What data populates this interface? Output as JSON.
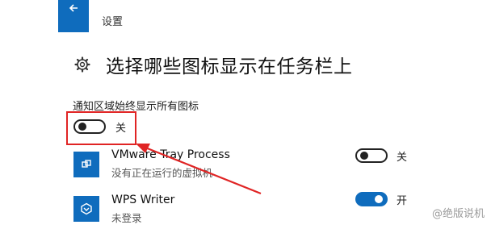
{
  "header": {
    "window_title": "设置"
  },
  "page": {
    "title": "选择哪些图标显示在任务栏上"
  },
  "always_show": {
    "label": "通知区域始终显示所有图标",
    "toggle_text": "关",
    "state": "off"
  },
  "apps": [
    {
      "name": "VMware Tray Process",
      "status": "没有正在运行的虚拟机",
      "toggle_text": "关",
      "state": "off",
      "icon": "vmware-icon"
    },
    {
      "name": "WPS Writer",
      "status": "未登录",
      "toggle_text": "开",
      "state": "on",
      "icon": "wps-writer-icon"
    }
  ],
  "watermark": "@绝版说机",
  "colors": {
    "accent": "#0f6cbd",
    "annotation": "#e02424"
  }
}
